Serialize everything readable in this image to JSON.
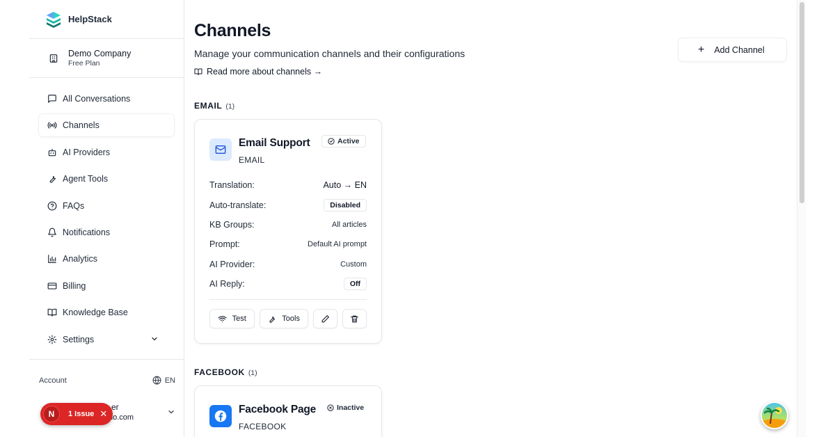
{
  "brand": {
    "name": "HelpStack"
  },
  "company": {
    "name": "Demo Company",
    "plan": "Free Plan"
  },
  "sidebar": {
    "items": [
      {
        "label": "All Conversations",
        "icon": "message-square-icon"
      },
      {
        "label": "Channels",
        "icon": "radio-icon",
        "active": true
      },
      {
        "label": "AI Providers",
        "icon": "bot-icon"
      },
      {
        "label": "Agent Tools",
        "icon": "wrench-icon"
      },
      {
        "label": "FAQs",
        "icon": "help-circle-icon"
      },
      {
        "label": "Notifications",
        "icon": "bell-icon"
      },
      {
        "label": "Analytics",
        "icon": "bar-chart-icon"
      },
      {
        "label": "Billing",
        "icon": "credit-card-icon"
      },
      {
        "label": "Knowledge Base",
        "icon": "book-open-icon"
      },
      {
        "label": "Settings",
        "icon": "gear-icon"
      }
    ]
  },
  "account": {
    "label": "Account",
    "language": "EN",
    "user_name_partial": "er",
    "user_email_partial": "no.com"
  },
  "issue": {
    "initial": "N",
    "label": "1 Issue",
    "close": "✕"
  },
  "page": {
    "title": "Channels",
    "subtitle": "Manage your communication channels and their configurations",
    "read_more": "Read more about channels →",
    "add_button": "Add Channel",
    "add_plus": "+"
  },
  "sections": [
    {
      "label": "EMAIL",
      "count": "(1)",
      "card": {
        "name": "Email Support",
        "type": "EMAIL",
        "status": "Active",
        "rows": [
          {
            "label": "Translation:",
            "value": "Auto → EN"
          },
          {
            "label": "Auto-translate:",
            "value": "Disabled"
          },
          {
            "label": "KB Groups:",
            "value": "All articles"
          },
          {
            "label": "Prompt:",
            "value": "Default AI prompt"
          },
          {
            "label": "AI Provider:",
            "value": "Custom"
          },
          {
            "label": "AI Reply:",
            "value": "Off"
          }
        ],
        "actions": {
          "test": "Test",
          "tools": "Tools"
        }
      }
    },
    {
      "label": "FACEBOOK",
      "count": "(1)",
      "card": {
        "name": "Facebook Page",
        "type": "FACEBOOK",
        "status": "Inactive"
      }
    }
  ],
  "colors": {
    "facebook": "#1877f2",
    "email_icon_bg": "#dbeafe",
    "issue_red": "#dc2626"
  }
}
